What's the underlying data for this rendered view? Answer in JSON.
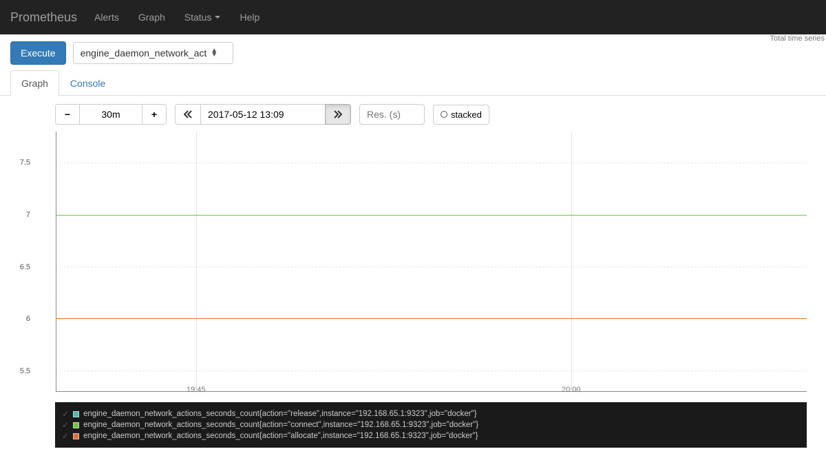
{
  "navbar": {
    "brand": "Prometheus",
    "items": [
      "Alerts",
      "Graph",
      "Status",
      "Help"
    ],
    "dropdown_index": 2
  },
  "meta": {
    "total_series": "Total time series"
  },
  "query": {
    "execute_label": "Execute",
    "expression": "engine_daemon_network_act"
  },
  "tabs": {
    "graph": "Graph",
    "console": "Console",
    "active": "graph"
  },
  "controls": {
    "range": "30m",
    "datetime": "2017-05-12 13:09",
    "resolution_placeholder": "Res. (s)",
    "stacked_label": "stacked"
  },
  "chart_data": {
    "type": "line",
    "ylim": [
      5.3,
      7.8
    ],
    "y_ticks": [
      5.5,
      6,
      6.5,
      7,
      7.5
    ],
    "x_ticks": [
      {
        "label": "19:45",
        "pos": 0.186
      },
      {
        "label": "20:00",
        "pos": 0.686
      }
    ],
    "v_grid": [
      0.186,
      0.686
    ],
    "series": [
      {
        "name": "engine_daemon_network_actions_seconds_count{action=\"release\",instance=\"192.168.65.1:9323\",job=\"docker\"}",
        "value": 6,
        "color": "#52b9b4"
      },
      {
        "name": "engine_daemon_network_actions_seconds_count{action=\"connect\",instance=\"192.168.65.1:9323\",job=\"docker\"}",
        "value": 7,
        "color": "#6cc644"
      },
      {
        "name": "engine_daemon_network_actions_seconds_count{action=\"allocate\",instance=\"192.168.65.1:9323\",job=\"docker\"}",
        "value": 6,
        "color": "#e06f3c"
      }
    ]
  }
}
